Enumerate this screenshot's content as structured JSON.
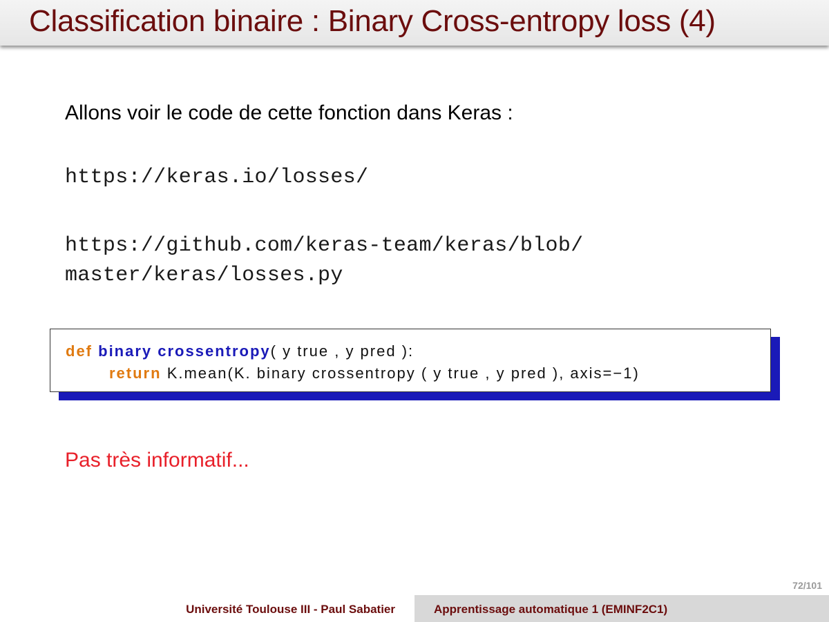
{
  "slide": {
    "title": "Classification binaire : Binary Cross-entropy loss (4)",
    "intro": "Allons voir le code de cette fonction dans Keras :",
    "link1": "https://keras.io/losses/",
    "link2_line1": "https://github.com/keras-team/keras/blob/",
    "link2_line2": "master/keras/losses.py",
    "remark": "Pas très informatif...",
    "page_number": "72/101"
  },
  "code": {
    "kw_def": "def",
    "fn_name": "binary crossentropy",
    "line1_rest": "( y true ,  y pred ):",
    "kw_return": "return",
    "line2_rest": "K.mean(K. binary crossentropy ( y true ,  y pred ),  axis=−1)"
  },
  "footer": {
    "left": "Université Toulouse III - Paul Sabatier",
    "right": "Apprentissage automatique 1 (EMINF2C1)"
  },
  "colors": {
    "title": "#6b0d0d",
    "keyword": "#e07a10",
    "function": "#1a1ab8",
    "remark": "#e8202a",
    "code_shadow": "#1a1ab8"
  }
}
